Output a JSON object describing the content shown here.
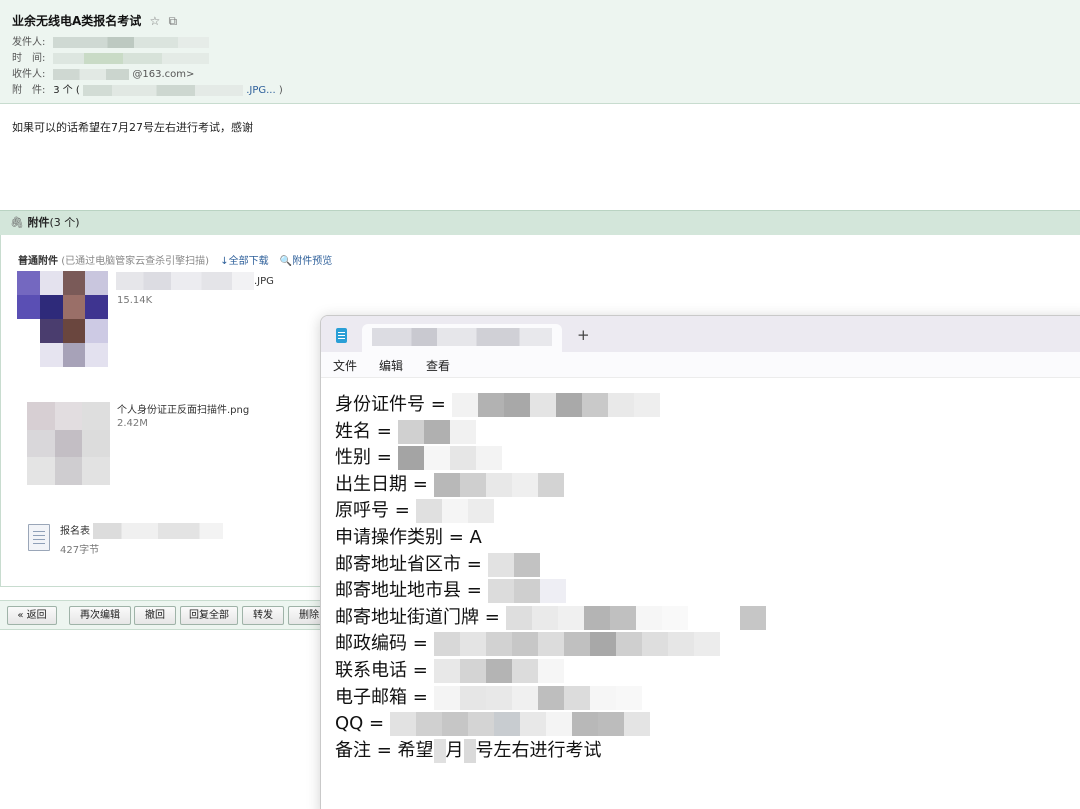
{
  "email": {
    "subject": "业余无线电A类报名考试",
    "star_icon": "star-outline-icon",
    "popout_icon": "window-popout-icon",
    "sender_label": "发件人:",
    "time_label": "时　间:",
    "recipient_label": "收件人:",
    "recipient_domain": "@163.com>",
    "attachment_label": "附　件:",
    "attachment_count": "3 个 (",
    "attachment_name_end": ".JPG...",
    "attachment_close": ")",
    "body": "如果可以的话希望在7月27号左右进行考试，感谢"
  },
  "attachments": {
    "bar_title": "附件",
    "bar_count": "(3 个)",
    "section_title": "普通附件",
    "scan_note": "(已通过电脑管家云查杀引擎扫描)",
    "download_all": "全部下载",
    "preview": "附件预览",
    "files": [
      {
        "ext": ".JPG",
        "size": "15.14K"
      },
      {
        "name": "个人身份证正反面扫描件.png",
        "size": "2.42M"
      },
      {
        "name": "报名表",
        "size": "427字节"
      }
    ]
  },
  "toolbar": {
    "back": "« 返回",
    "reedit": "再次编辑",
    "recall": "撤回",
    "reply_all": "回复全部",
    "forward": "转发",
    "delete": "删除"
  },
  "notepad": {
    "new_tab": "+",
    "menu": [
      "文件",
      "编辑",
      "查看"
    ],
    "lines": [
      {
        "label": "身份证件号 = ",
        "value": ""
      },
      {
        "label": "姓名 = ",
        "value": ""
      },
      {
        "label": "性别 = ",
        "value": ""
      },
      {
        "label": "出生日期 = ",
        "value": ""
      },
      {
        "label": "原呼号 = ",
        "value": ""
      },
      {
        "label": "申请操作类别 = ",
        "value": "A"
      },
      {
        "label": "邮寄地址省区市 = ",
        "value": ""
      },
      {
        "label": "邮寄地址地市县 = ",
        "value": ""
      },
      {
        "label": "邮寄地址街道门牌 = ",
        "value": ""
      },
      {
        "label": "邮政编码 = ",
        "value": ""
      },
      {
        "label": "联系电话 = ",
        "value": ""
      },
      {
        "label": "电子邮箱 = ",
        "value": ""
      },
      {
        "label": "QQ = ",
        "value": ""
      },
      {
        "label": "备注 = 希望",
        "value": ""
      }
    ],
    "remark_month": "月",
    "remark_rest": "号左右进行考试"
  }
}
